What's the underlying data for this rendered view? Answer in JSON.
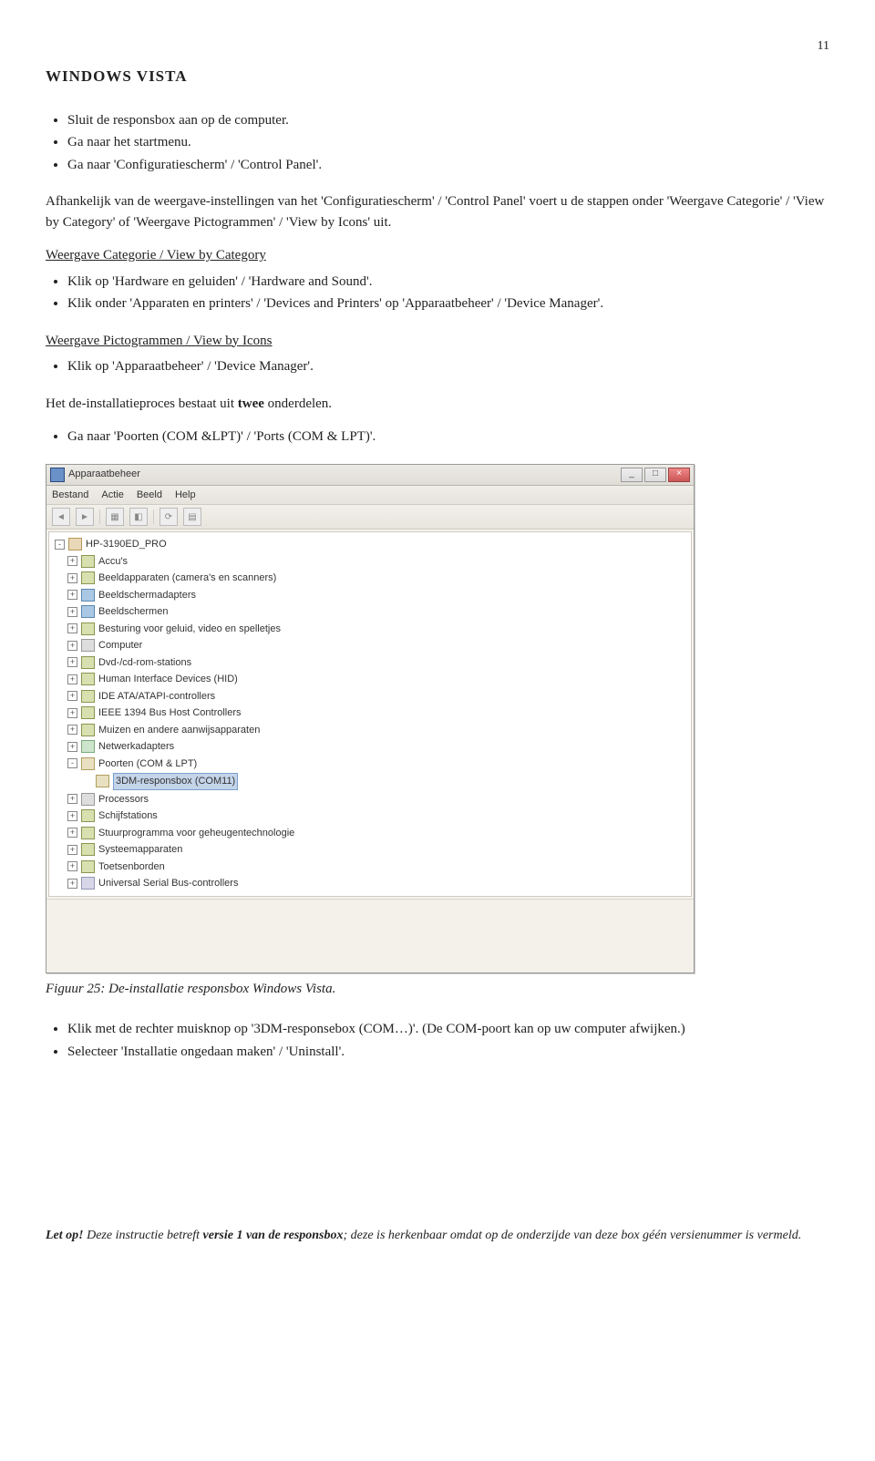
{
  "page_number": "11",
  "heading": "WINDOWS VISTA",
  "intro_bullets": [
    "Sluit de responsbox aan op de computer.",
    "Ga naar het startmenu.",
    "Ga naar 'Configuratiescherm' / 'Control Panel'."
  ],
  "intro_para": "Afhankelijk van de weergave-instellingen van het 'Configuratiescherm' / 'Control Panel' voert u de stappen onder 'Weergave Categorie' / 'View by Category' of 'Weergave Pictogrammen' / 'View by Icons' uit.",
  "cat_heading": "Weergave Categorie / View by Category",
  "cat_bullets": [
    "Klik op 'Hardware en geluiden' / 'Hardware and Sound'.",
    "Klik onder 'Apparaten en printers' / 'Devices and Printers' op 'Apparaatbeheer' / 'Device Manager'."
  ],
  "icon_heading": "Weergave Pictogrammen / View by Icons",
  "icon_bullets": [
    "Klik op 'Apparaatbeheer' / 'Device Manager'."
  ],
  "twee_line_pre": "Het de-installatieproces bestaat uit ",
  "twee_bold": "twee",
  "twee_line_post": " onderdelen.",
  "ports_bullet": "Ga naar 'Poorten (COM &LPT)' / 'Ports (COM & LPT)'.",
  "window": {
    "title": "Apparaatbeheer",
    "menu": [
      "Bestand",
      "Actie",
      "Beeld",
      "Help"
    ],
    "root": "HP-3190ED_PRO",
    "nodes": [
      {
        "label": "Accu's",
        "icon": "dev-icon"
      },
      {
        "label": "Beeldapparaten (camera's en scanners)",
        "icon": "dev-icon"
      },
      {
        "label": "Beeldschermadapters",
        "icon": "dev-icon mon"
      },
      {
        "label": "Beeldschermen",
        "icon": "dev-icon mon"
      },
      {
        "label": "Besturing voor geluid, video en spelletjes",
        "icon": "dev-icon"
      },
      {
        "label": "Computer",
        "icon": "dev-icon cpu"
      },
      {
        "label": "Dvd-/cd-rom-stations",
        "icon": "dev-icon"
      },
      {
        "label": "Human Interface Devices (HID)",
        "icon": "dev-icon"
      },
      {
        "label": "IDE ATA/ATAPI-controllers",
        "icon": "dev-icon"
      },
      {
        "label": "IEEE 1394 Bus Host Controllers",
        "icon": "dev-icon"
      },
      {
        "label": "Muizen en andere aanwijsapparaten",
        "icon": "dev-icon"
      },
      {
        "label": "Netwerkadapters",
        "icon": "dev-icon net"
      },
      {
        "label": "Poorten (COM & LPT)",
        "icon": "dev-icon port",
        "expanded": true,
        "children": [
          {
            "label": "3DM-responsbox (COM11)",
            "icon": "dev-icon port",
            "selected": true
          }
        ]
      },
      {
        "label": "Processors",
        "icon": "dev-icon cpu"
      },
      {
        "label": "Schijfstations",
        "icon": "dev-icon"
      },
      {
        "label": "Stuurprogramma voor geheugentechnologie",
        "icon": "dev-icon"
      },
      {
        "label": "Systeemapparaten",
        "icon": "dev-icon"
      },
      {
        "label": "Toetsenborden",
        "icon": "dev-icon"
      },
      {
        "label": "Universal Serial Bus-controllers",
        "icon": "dev-icon usb"
      }
    ]
  },
  "caption": "Figuur 25: De-installatie responsbox Windows Vista.",
  "post_bullets": [
    "Klik met de rechter muisknop op '3DM-responsebox (COM…)'. (De COM-poort kan op uw computer afwijken.)",
    "Selecteer 'Installatie ongedaan maken' / 'Uninstall'."
  ],
  "footnote_pre": "Let op! ",
  "footnote_mid1": "Deze instructie betreft ",
  "footnote_bold": "versie 1 van de responsbox",
  "footnote_post": "; deze is herkenbaar omdat op de onderzijde van deze box géén versienummer is vermeld."
}
